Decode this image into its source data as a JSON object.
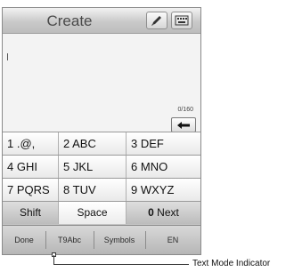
{
  "header": {
    "title": "Create",
    "pen_icon": "pen-icon",
    "keyboard_icon": "keyboard-icon"
  },
  "compose": {
    "char_counter": "0/160",
    "backspace_icon": "left-arrow-icon"
  },
  "keypad": {
    "rows": [
      [
        {
          "num": "1",
          "letters": ".@,"
        },
        {
          "num": "2",
          "letters": "ABC"
        },
        {
          "num": "3",
          "letters": "DEF"
        }
      ],
      [
        {
          "num": "4",
          "letters": "GHI"
        },
        {
          "num": "5",
          "letters": "JKL"
        },
        {
          "num": "6",
          "letters": "MNO"
        }
      ],
      [
        {
          "num": "7",
          "letters": "PQRS"
        },
        {
          "num": "8",
          "letters": "TUV"
        },
        {
          "num": "9",
          "letters": "WXYZ"
        }
      ]
    ],
    "shift": "Shift",
    "space": "Space",
    "next_num": "0",
    "next_label": "Next"
  },
  "bottom_bar": {
    "done": "Done",
    "text_mode": "T9Abc",
    "symbols": "Symbols",
    "language": "EN"
  },
  "callout": {
    "label": "Text Mode Indicator"
  }
}
